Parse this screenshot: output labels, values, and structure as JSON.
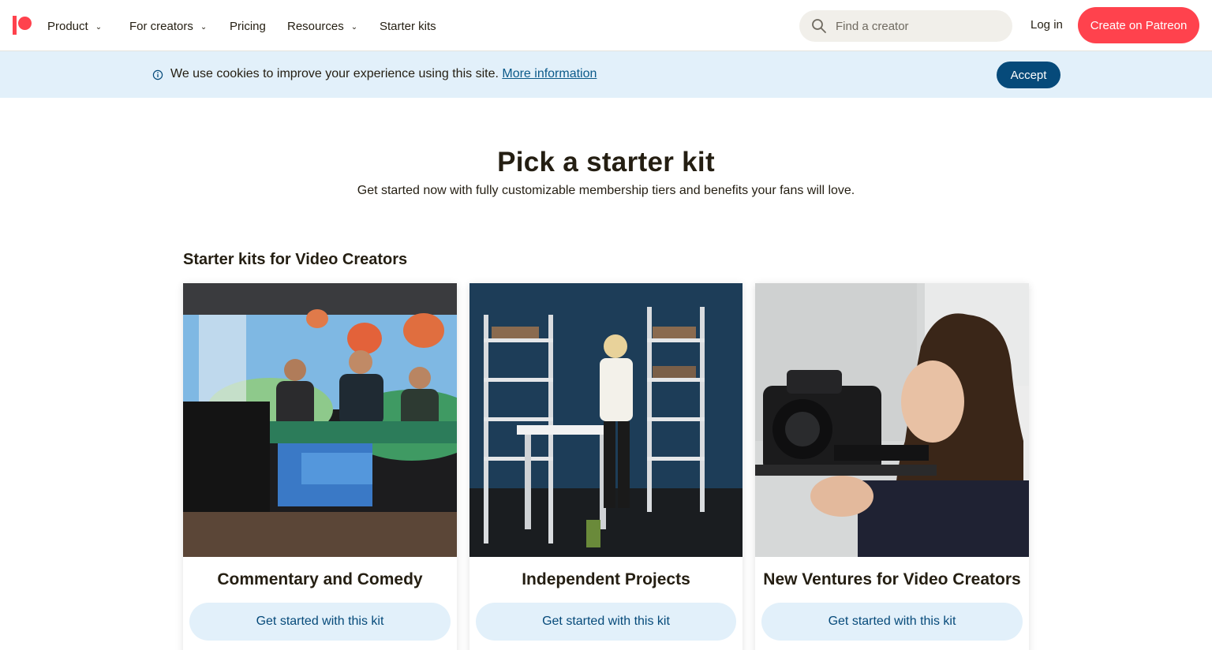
{
  "nav": {
    "items": [
      {
        "label": "Product",
        "has_dropdown": true
      },
      {
        "label": "For creators",
        "has_dropdown": true
      },
      {
        "label": "Pricing",
        "has_dropdown": false
      },
      {
        "label": "Resources",
        "has_dropdown": true
      },
      {
        "label": "Starter kits",
        "has_dropdown": false
      }
    ],
    "search_placeholder": "Find a creator",
    "login_label": "Log in",
    "create_label": "Create on Patreon",
    "brand_color": "#ff424d"
  },
  "cookie": {
    "text": "We use cookies to improve your experience using this site.",
    "link": "More information",
    "accept": "Accept"
  },
  "hero": {
    "title": "Pick a starter kit",
    "subtitle": "Get started now with fully customizable membership tiers and benefits your fans will love."
  },
  "section": {
    "title": "Starter kits for Video Creators"
  },
  "cards": [
    {
      "title": "Commentary and Comedy",
      "button": "Get started with this kit"
    },
    {
      "title": "Independent Projects",
      "button": "Get started with this kit"
    },
    {
      "title": "New Ventures for Video Creators",
      "button": "Get started with this kit"
    }
  ],
  "icons": {
    "logo": "patreon-logo-icon",
    "search": "search-icon",
    "info": "info-icon",
    "dropdown": "chevron-down-icon"
  }
}
